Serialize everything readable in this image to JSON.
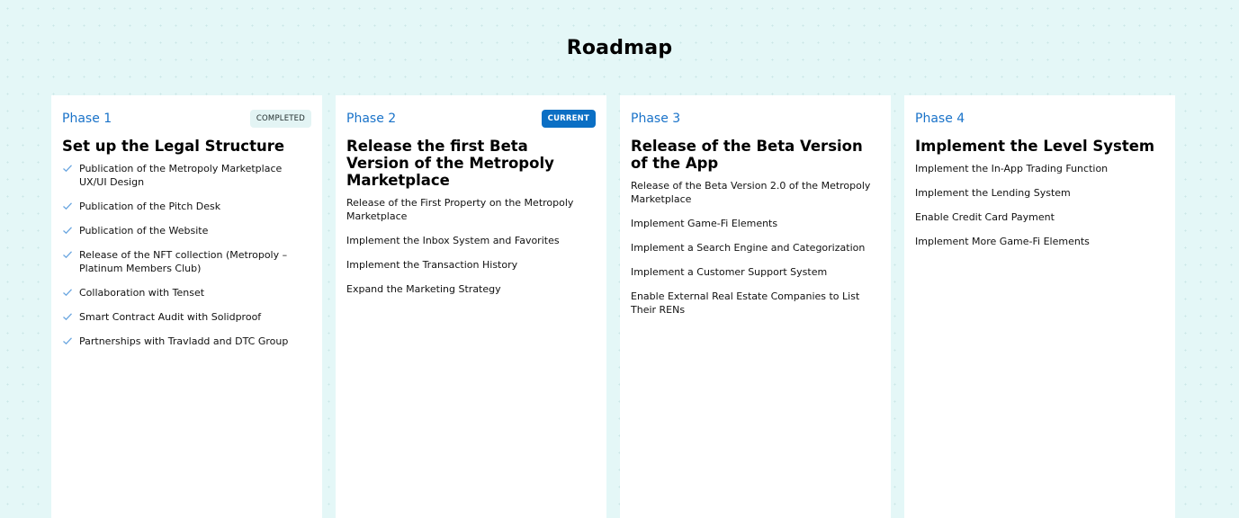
{
  "page": {
    "title": "Roadmap"
  },
  "colors": {
    "accent": "#1a73c9",
    "current_badge": "#0b6fc4",
    "completed_badge_bg": "#e3f4f4",
    "check": "#6aa6e0"
  },
  "phases": [
    {
      "label": "Phase 1",
      "badge": "COMPLETED",
      "title": "Set up the Legal Structure",
      "item_icon": "check-icon",
      "items": [
        "Publication of the Metropoly Marketplace UX/UI Design",
        "Publication of the Pitch Desk",
        "Publication of the Website",
        "Release of the NFT collection (Metropoly – Platinum Members Club)",
        "Collaboration with Tenset",
        "Smart Contract Audit with Solidproof",
        "Partnerships with Travladd and DTC Group"
      ]
    },
    {
      "label": "Phase 2",
      "badge": "CURRENT",
      "title": "Release the first Beta Version of the Metropoly Marketplace",
      "items": [
        "Release of the First Property on the Metropoly Marketplace",
        "Implement the Inbox System and Favorites",
        "Implement the Transaction History",
        "Expand the Marketing Strategy"
      ]
    },
    {
      "label": "Phase 3",
      "title": "Release of the Beta Version of the App",
      "items": [
        "Release of the Beta Version 2.0 of the Metropoly Marketplace",
        "Implement Game-Fi Elements",
        "Implement a Search Engine and Categorization",
        "Implement a Customer Support System",
        "Enable External Real Estate Companies to List Their RENs"
      ]
    },
    {
      "label": "Phase 4",
      "title": "Implement the Level System",
      "items": [
        "Implement the In-App Trading Function",
        "Implement the Lending System",
        "Enable Credit Card Payment",
        "Implement More Game-Fi Elements"
      ]
    }
  ]
}
